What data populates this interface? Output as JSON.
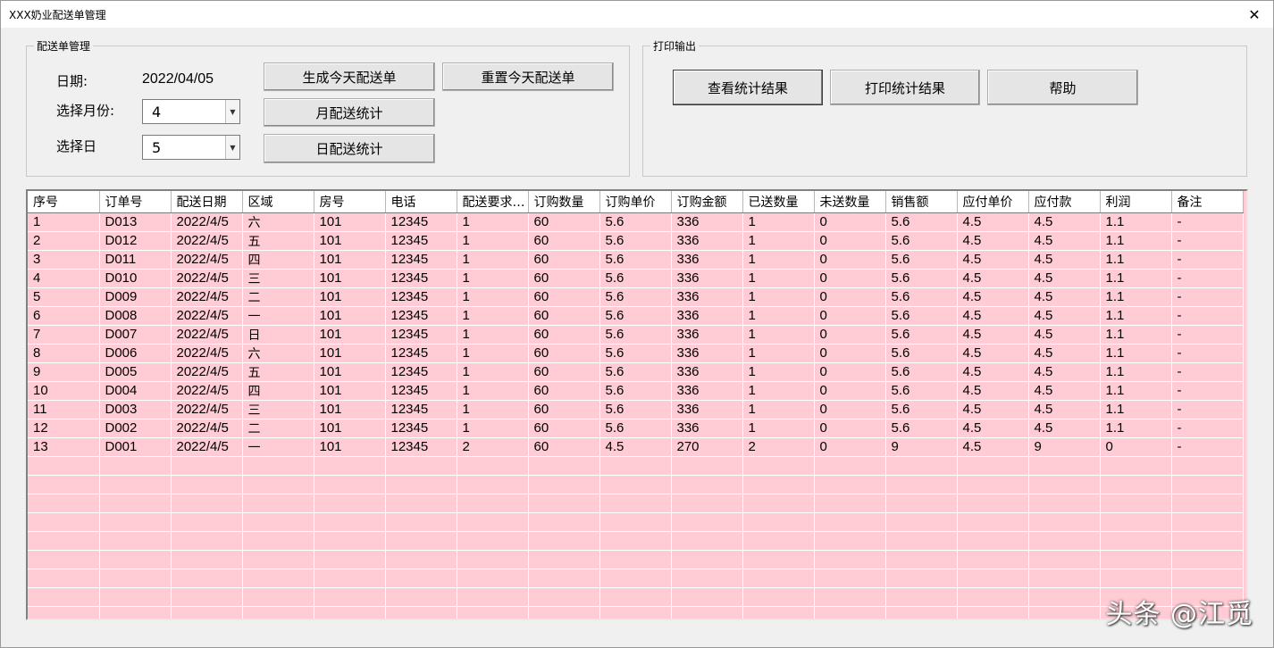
{
  "window": {
    "title": "XXX奶业配送单管理",
    "close_label": "✕"
  },
  "delivery_group": {
    "legend": "配送单管理",
    "date_label": "日期:",
    "date_value": "2022/04/05",
    "month_label": "选择月份:",
    "month_value": "4",
    "day_label": "选择日",
    "day_value": "5",
    "btn_generate": "生成今天配送单",
    "btn_reset": "重置今天配送单",
    "btn_month_stats": "月配送统计",
    "btn_day_stats": "日配送统计"
  },
  "print_group": {
    "legend": "打印输出",
    "btn_view": "查看统计结果",
    "btn_print": "打印统计结果",
    "btn_help": "帮助"
  },
  "table": {
    "columns": [
      "序号",
      "订单号",
      "配送日期",
      "区域",
      "房号",
      "电话",
      "配送要求…",
      "订购数量",
      "订购单价",
      "订购金额",
      "已送数量",
      "未送数量",
      "销售额",
      "应付单价",
      "应付款",
      "利润",
      "备注"
    ],
    "rows": [
      [
        "1",
        "D013",
        "2022/4/5",
        "六",
        "101",
        "12345",
        "1",
        "60",
        "5.6",
        "336",
        "1",
        "0",
        "5.6",
        "4.5",
        "4.5",
        "1.1",
        "-"
      ],
      [
        "2",
        "D012",
        "2022/4/5",
        "五",
        "101",
        "12345",
        "1",
        "60",
        "5.6",
        "336",
        "1",
        "0",
        "5.6",
        "4.5",
        "4.5",
        "1.1",
        "-"
      ],
      [
        "3",
        "D011",
        "2022/4/5",
        "四",
        "101",
        "12345",
        "1",
        "60",
        "5.6",
        "336",
        "1",
        "0",
        "5.6",
        "4.5",
        "4.5",
        "1.1",
        "-"
      ],
      [
        "4",
        "D010",
        "2022/4/5",
        "三",
        "101",
        "12345",
        "1",
        "60",
        "5.6",
        "336",
        "1",
        "0",
        "5.6",
        "4.5",
        "4.5",
        "1.1",
        "-"
      ],
      [
        "5",
        "D009",
        "2022/4/5",
        "二",
        "101",
        "12345",
        "1",
        "60",
        "5.6",
        "336",
        "1",
        "0",
        "5.6",
        "4.5",
        "4.5",
        "1.1",
        "-"
      ],
      [
        "6",
        "D008",
        "2022/4/5",
        "一",
        "101",
        "12345",
        "1",
        "60",
        "5.6",
        "336",
        "1",
        "0",
        "5.6",
        "4.5",
        "4.5",
        "1.1",
        "-"
      ],
      [
        "7",
        "D007",
        "2022/4/5",
        "日",
        "101",
        "12345",
        "1",
        "60",
        "5.6",
        "336",
        "1",
        "0",
        "5.6",
        "4.5",
        "4.5",
        "1.1",
        "-"
      ],
      [
        "8",
        "D006",
        "2022/4/5",
        "六",
        "101",
        "12345",
        "1",
        "60",
        "5.6",
        "336",
        "1",
        "0",
        "5.6",
        "4.5",
        "4.5",
        "1.1",
        "-"
      ],
      [
        "9",
        "D005",
        "2022/4/5",
        "五",
        "101",
        "12345",
        "1",
        "60",
        "5.6",
        "336",
        "1",
        "0",
        "5.6",
        "4.5",
        "4.5",
        "1.1",
        "-"
      ],
      [
        "10",
        "D004",
        "2022/4/5",
        "四",
        "101",
        "12345",
        "1",
        "60",
        "5.6",
        "336",
        "1",
        "0",
        "5.6",
        "4.5",
        "4.5",
        "1.1",
        "-"
      ],
      [
        "11",
        "D003",
        "2022/4/5",
        "三",
        "101",
        "12345",
        "1",
        "60",
        "5.6",
        "336",
        "1",
        "0",
        "5.6",
        "4.5",
        "4.5",
        "1.1",
        "-"
      ],
      [
        "12",
        "D002",
        "2022/4/5",
        "二",
        "101",
        "12345",
        "1",
        "60",
        "5.6",
        "336",
        "1",
        "0",
        "5.6",
        "4.5",
        "4.5",
        "1.1",
        "-"
      ],
      [
        "13",
        "D001",
        "2022/4/5",
        "一",
        "101",
        "12345",
        "2",
        "60",
        "4.5",
        "270",
        "2",
        "0",
        "9",
        "4.5",
        "9",
        "0",
        "-"
      ]
    ],
    "empty_rows": 9,
    "row_color": "#ffccd5"
  },
  "watermark": "头条 @江觅",
  "icons": {
    "combo_arrow": "chevron-down-icon",
    "close": "close-icon"
  }
}
